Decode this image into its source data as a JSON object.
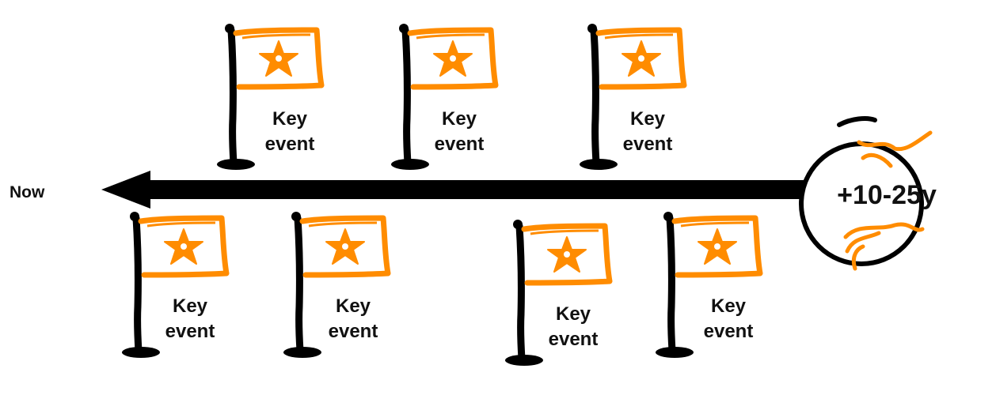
{
  "timeline": {
    "start_label": "Now",
    "horizon_label": "+10-25y",
    "accent_color": "#ff8c00",
    "line_color": "#000000"
  },
  "events": [
    {
      "line1": "Key",
      "line2": "event",
      "icon": "flag-star-icon"
    },
    {
      "line1": "Key",
      "line2": "event",
      "icon": "flag-star-icon"
    },
    {
      "line1": "Key",
      "line2": "event",
      "icon": "flag-star-icon"
    },
    {
      "line1": "Key",
      "line2": "event",
      "icon": "flag-star-icon"
    },
    {
      "line1": "Key",
      "line2": "event",
      "icon": "flag-star-icon"
    },
    {
      "line1": "Key",
      "line2": "event",
      "icon": "flag-star-icon"
    },
    {
      "line1": "Key",
      "line2": "event",
      "icon": "flag-star-icon"
    }
  ]
}
